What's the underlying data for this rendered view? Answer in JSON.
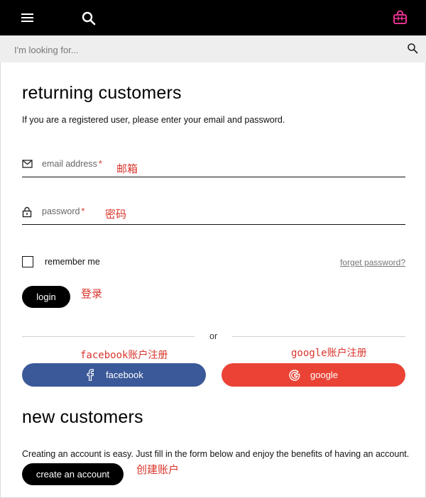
{
  "header": {
    "menu_icon": "hamburger-menu-icon",
    "search_icon": "search-icon",
    "bag_icon": "shopping-bag-icon",
    "bag_color": "#e6338f"
  },
  "search": {
    "placeholder": "I'm looking for..."
  },
  "returning": {
    "title": "returning customers",
    "subtitle": "If you are a registered user, please enter your email and password.",
    "email_label": "email address",
    "password_label": "password",
    "required_mark": "*",
    "email_note": "邮箱",
    "password_note": "密码",
    "remember_label": "remember me",
    "forget_link": "forget password?",
    "login_label": "login",
    "login_note": "登录"
  },
  "social": {
    "or_label": "or",
    "facebook_note": "facebook账户注册",
    "google_note": "google账户注册",
    "facebook_label": "facebook",
    "google_label": "google",
    "facebook_color": "#3b5998",
    "google_color": "#ea4335"
  },
  "new_customers": {
    "title": "new customers",
    "text": "Creating an account is easy. Just fill in the form below and enjoy the benefits of having an account.",
    "create_label": "create an account",
    "create_note": "创建账户"
  },
  "annotation_color": "#d9342b"
}
